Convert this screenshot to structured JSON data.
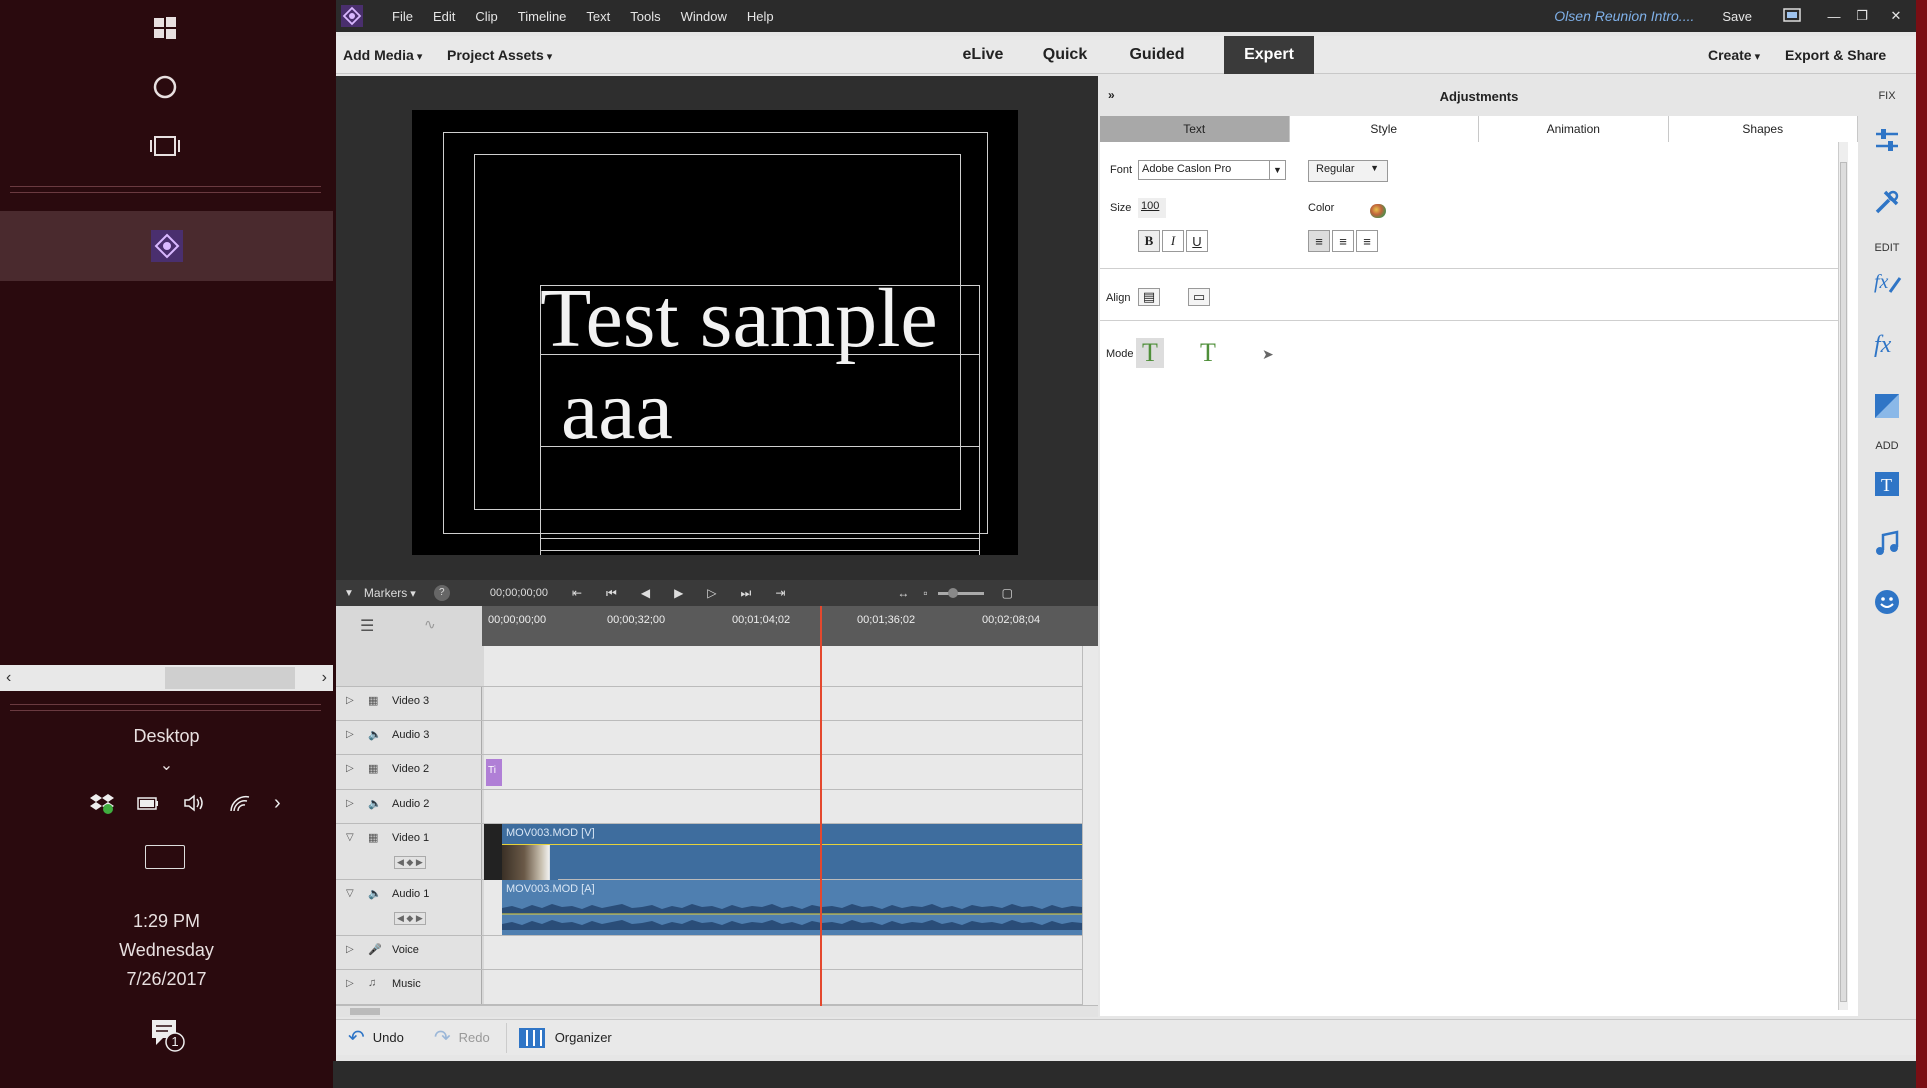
{
  "taskbar": {
    "desktop_label": "Desktop",
    "time": "1:29 PM",
    "day": "Wednesday",
    "date": "7/26/2017",
    "notification_count": "1",
    "icons": [
      "windows-start-icon",
      "cortana-icon",
      "task-view-icon",
      "premiere-elements-icon",
      "dropbox-icon",
      "battery-icon",
      "volume-icon",
      "wifi-icon",
      "chevron-right-icon",
      "keyboard-icon",
      "action-center-icon"
    ]
  },
  "menubar": {
    "items": [
      "File",
      "Edit",
      "Clip",
      "Timeline",
      "Text",
      "Tools",
      "Window",
      "Help"
    ],
    "project_title": "Olsen Reunion Intro....",
    "save": "Save"
  },
  "modebar": {
    "add_media": "Add Media",
    "project_assets": "Project Assets",
    "modes": [
      "eLive",
      "Quick",
      "Guided",
      "Expert"
    ],
    "active_mode": "Expert",
    "create": "Create",
    "export_share": "Export & Share"
  },
  "monitor": {
    "title_text_line1": "Test sample",
    "title_text_line2": " aaa"
  },
  "timeline": {
    "markers": "Markers",
    "help": "?",
    "current_timecode": "00;00;00;00",
    "ruler": [
      "00;00;00;00",
      "00;00;32;00",
      "00;01;04;02",
      "00;01;36;02",
      "00;02;08;04"
    ],
    "tracks": {
      "video3": "Video 3",
      "audio3": "Audio 3",
      "video2": "Video 2",
      "audio2": "Audio 2",
      "video1": "Video 1",
      "audio1": "Audio 1",
      "voice": "Voice",
      "music": "Music"
    },
    "title_clip": "Ti",
    "video_clip": "MOV003.MOD [V]",
    "audio_clip": "MOV003.MOD [A]"
  },
  "adjustments": {
    "title": "Adjustments",
    "tabs": [
      "Text",
      "Style",
      "Animation",
      "Shapes"
    ],
    "active_tab": "Text",
    "font_label": "Font",
    "font_value": "Adobe Caslon Pro",
    "style_value": "Regular",
    "size_label": "Size",
    "size_value": "100",
    "color_label": "Color",
    "bold": "B",
    "italic": "I",
    "underline": "U",
    "align_label": "Align",
    "mode_label": "Mode",
    "mode_horizontal": "T",
    "mode_vertical": "T"
  },
  "rail": {
    "fix": "FIX",
    "edit": "EDIT",
    "add": "ADD",
    "fx": "fx"
  },
  "bottombar": {
    "undo": "Undo",
    "redo": "Redo",
    "organizer": "Organizer"
  },
  "colors": {
    "taskbar_bg": "#2a0a0e",
    "accent_blue": "#3e6d9e",
    "playhead": "#e4482e",
    "title_clip": "#b07fd6",
    "project_title": "#7fb0e8"
  }
}
